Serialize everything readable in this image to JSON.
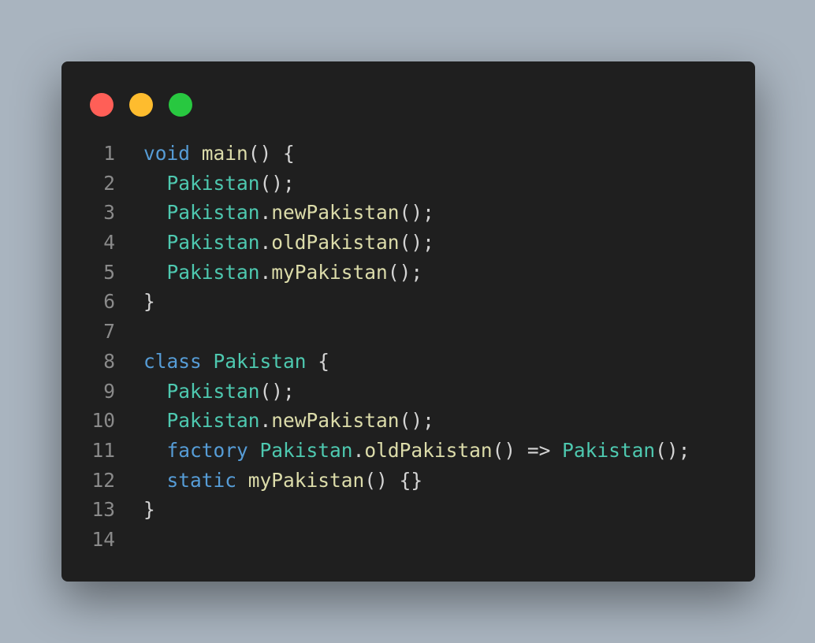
{
  "window": {
    "controls": [
      {
        "name": "close",
        "color": "#ff5f57"
      },
      {
        "name": "minimize",
        "color": "#febc2e"
      },
      {
        "name": "maximize",
        "color": "#28c840"
      }
    ]
  },
  "colors": {
    "keyword": "#569cd6",
    "type": "#4ec9b0",
    "function": "#dcdcaa",
    "punctuation": "#d4d4d4",
    "line_number": "#8a8a8a",
    "background": "#1f1f1f"
  },
  "code": {
    "lines": [
      {
        "number": "1",
        "tokens": [
          {
            "text": "void",
            "kind": "keyword"
          },
          {
            "text": " ",
            "kind": "punctuation"
          },
          {
            "text": "main",
            "kind": "function"
          },
          {
            "text": "() {",
            "kind": "punctuation"
          }
        ]
      },
      {
        "number": "2",
        "tokens": [
          {
            "text": "  ",
            "kind": "punctuation"
          },
          {
            "text": "Pakistan",
            "kind": "type"
          },
          {
            "text": "();",
            "kind": "punctuation"
          }
        ]
      },
      {
        "number": "3",
        "tokens": [
          {
            "text": "  ",
            "kind": "punctuation"
          },
          {
            "text": "Pakistan",
            "kind": "type"
          },
          {
            "text": ".",
            "kind": "punctuation"
          },
          {
            "text": "newPakistan",
            "kind": "function"
          },
          {
            "text": "();",
            "kind": "punctuation"
          }
        ]
      },
      {
        "number": "4",
        "tokens": [
          {
            "text": "  ",
            "kind": "punctuation"
          },
          {
            "text": "Pakistan",
            "kind": "type"
          },
          {
            "text": ".",
            "kind": "punctuation"
          },
          {
            "text": "oldPakistan",
            "kind": "function"
          },
          {
            "text": "();",
            "kind": "punctuation"
          }
        ]
      },
      {
        "number": "5",
        "tokens": [
          {
            "text": "  ",
            "kind": "punctuation"
          },
          {
            "text": "Pakistan",
            "kind": "type"
          },
          {
            "text": ".",
            "kind": "punctuation"
          },
          {
            "text": "myPakistan",
            "kind": "function"
          },
          {
            "text": "();",
            "kind": "punctuation"
          }
        ]
      },
      {
        "number": "6",
        "tokens": [
          {
            "text": "}",
            "kind": "punctuation"
          }
        ]
      },
      {
        "number": "7",
        "tokens": []
      },
      {
        "number": "8",
        "tokens": [
          {
            "text": "class",
            "kind": "keyword"
          },
          {
            "text": " ",
            "kind": "punctuation"
          },
          {
            "text": "Pakistan",
            "kind": "type"
          },
          {
            "text": " {",
            "kind": "punctuation"
          }
        ]
      },
      {
        "number": "9",
        "tokens": [
          {
            "text": "  ",
            "kind": "punctuation"
          },
          {
            "text": "Pakistan",
            "kind": "type"
          },
          {
            "text": "();",
            "kind": "punctuation"
          }
        ]
      },
      {
        "number": "10",
        "tokens": [
          {
            "text": "  ",
            "kind": "punctuation"
          },
          {
            "text": "Pakistan",
            "kind": "type"
          },
          {
            "text": ".",
            "kind": "punctuation"
          },
          {
            "text": "newPakistan",
            "kind": "function"
          },
          {
            "text": "();",
            "kind": "punctuation"
          }
        ]
      },
      {
        "number": "11",
        "tokens": [
          {
            "text": "  ",
            "kind": "punctuation"
          },
          {
            "text": "factory",
            "kind": "keyword"
          },
          {
            "text": " ",
            "kind": "punctuation"
          },
          {
            "text": "Pakistan",
            "kind": "type"
          },
          {
            "text": ".",
            "kind": "punctuation"
          },
          {
            "text": "oldPakistan",
            "kind": "function"
          },
          {
            "text": "() => ",
            "kind": "punctuation"
          },
          {
            "text": "Pakistan",
            "kind": "type"
          },
          {
            "text": "();",
            "kind": "punctuation"
          }
        ]
      },
      {
        "number": "12",
        "tokens": [
          {
            "text": "  ",
            "kind": "punctuation"
          },
          {
            "text": "static",
            "kind": "keyword"
          },
          {
            "text": " ",
            "kind": "punctuation"
          },
          {
            "text": "myPakistan",
            "kind": "function"
          },
          {
            "text": "() {}",
            "kind": "punctuation"
          }
        ]
      },
      {
        "number": "13",
        "tokens": [
          {
            "text": "}",
            "kind": "punctuation"
          }
        ]
      },
      {
        "number": "14",
        "tokens": []
      }
    ]
  }
}
